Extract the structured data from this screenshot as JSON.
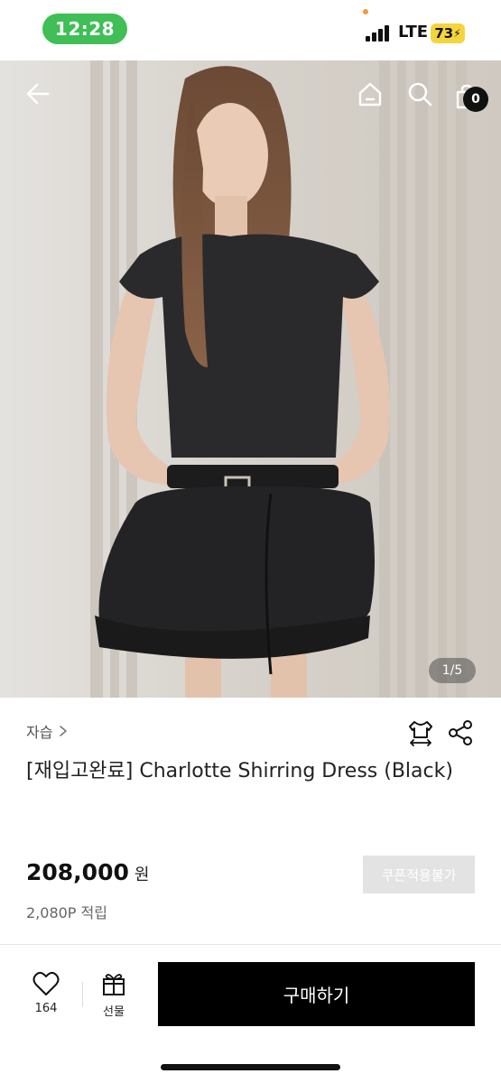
{
  "status_bar": {
    "time": "12:28",
    "network": "LTE",
    "battery": "73"
  },
  "header": {
    "cart_count": "0",
    "icons": [
      "back-arrow-icon",
      "home-icon",
      "search-icon",
      "shopping-bag-icon"
    ]
  },
  "gallery": {
    "indicator": "1/5"
  },
  "product": {
    "brand": "자습",
    "title": "[재입고완료] Charlotte Shirring Dress (Black)",
    "price": "208,000",
    "currency": "원",
    "coupon_label": "쿠폰적용불가",
    "points": "2,080P 적립"
  },
  "bottom_bar": {
    "like_count": "164",
    "gift_label": "선물",
    "buy_label": "구매하기"
  },
  "colors": {
    "time_pill": "#3fbf55",
    "battery": "#f5d53c",
    "buy_button": "#000000",
    "coupon_button": "#e3e3e3"
  }
}
